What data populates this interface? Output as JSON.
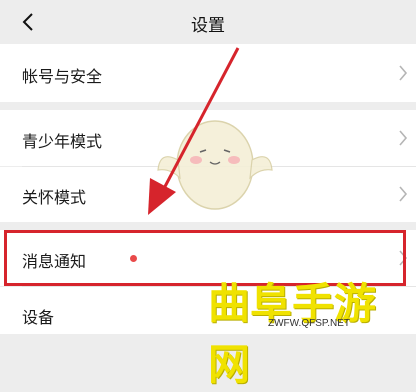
{
  "header": {
    "title": "设置"
  },
  "rows": [
    {
      "label": "帐号与安全"
    },
    {
      "label": "青少年模式"
    },
    {
      "label": "关怀模式"
    },
    {
      "label": "消息通知"
    },
    {
      "label": "设备"
    }
  ],
  "watermark": {
    "text": "曲阜手游网",
    "url": "ZWFW.QFSP.NET"
  },
  "colors": {
    "highlight": "#d6242c",
    "arrow": "#d6242c",
    "badge": "#e94a4a",
    "watermark": "#f0e200"
  }
}
